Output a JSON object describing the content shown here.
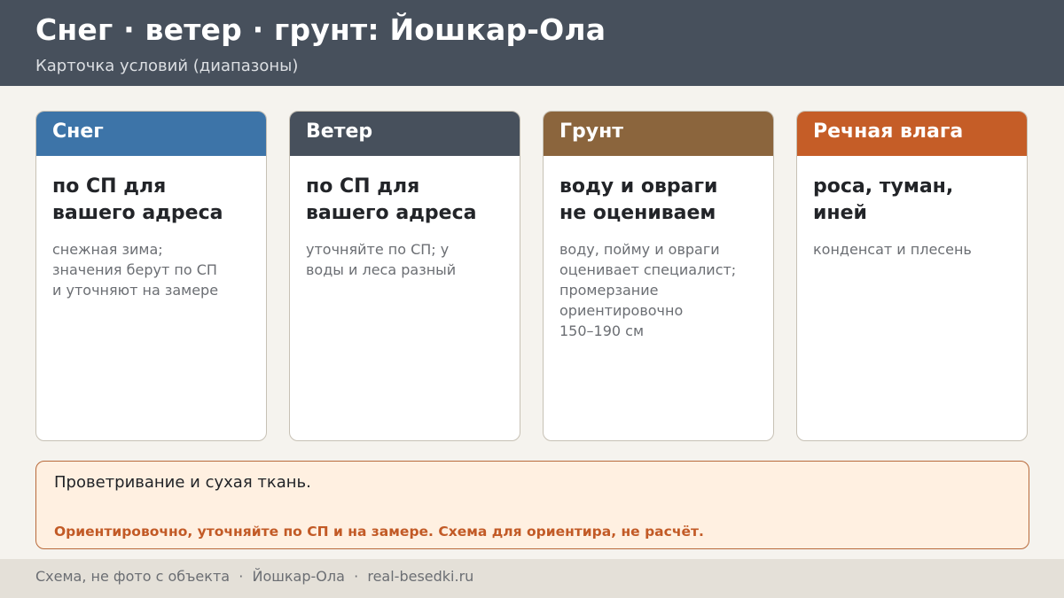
{
  "header": {
    "title": "Снег · ветер · грунт: Йошкар-Ола",
    "subtitle": "Карточка условий (диапазоны)"
  },
  "cards": [
    {
      "label": "Снег",
      "color": "#3d74a8",
      "title_lines": [
        "по СП для",
        "вашего адреса"
      ],
      "text_lines": [
        "снежная зима;",
        "значения берут по СП",
        "и уточняют на замере"
      ]
    },
    {
      "label": "Ветер",
      "color": "#47505c",
      "title_lines": [
        "по СП для",
        "вашего адреса"
      ],
      "text_lines": [
        "уточняйте по СП; у",
        "воды и леса разный"
      ]
    },
    {
      "label": "Грунт",
      "color": "#8b653d",
      "title_lines": [
        "воду и овраги",
        "не оцениваем"
      ],
      "text_lines": [
        "воду, пойму и овраги",
        "оценивает специалист;",
        "промерзание",
        "ориентировочно",
        "150–190 см"
      ]
    },
    {
      "label": "Речная влага",
      "color": "#c55d27",
      "title_lines": [
        "роса, туман,",
        "иней"
      ],
      "text_lines": [
        "конденсат и плесень"
      ]
    }
  ],
  "note": {
    "main": "Проветривание и сухая ткань.",
    "warning": "Ориентировочно, уточняйте по СП и на замере. Схема для ориентира, не расчёт."
  },
  "footer": {
    "text": "Схема, не фото с объекта  ·  Йошкар-Ола  ·  real-besedki.ru"
  }
}
